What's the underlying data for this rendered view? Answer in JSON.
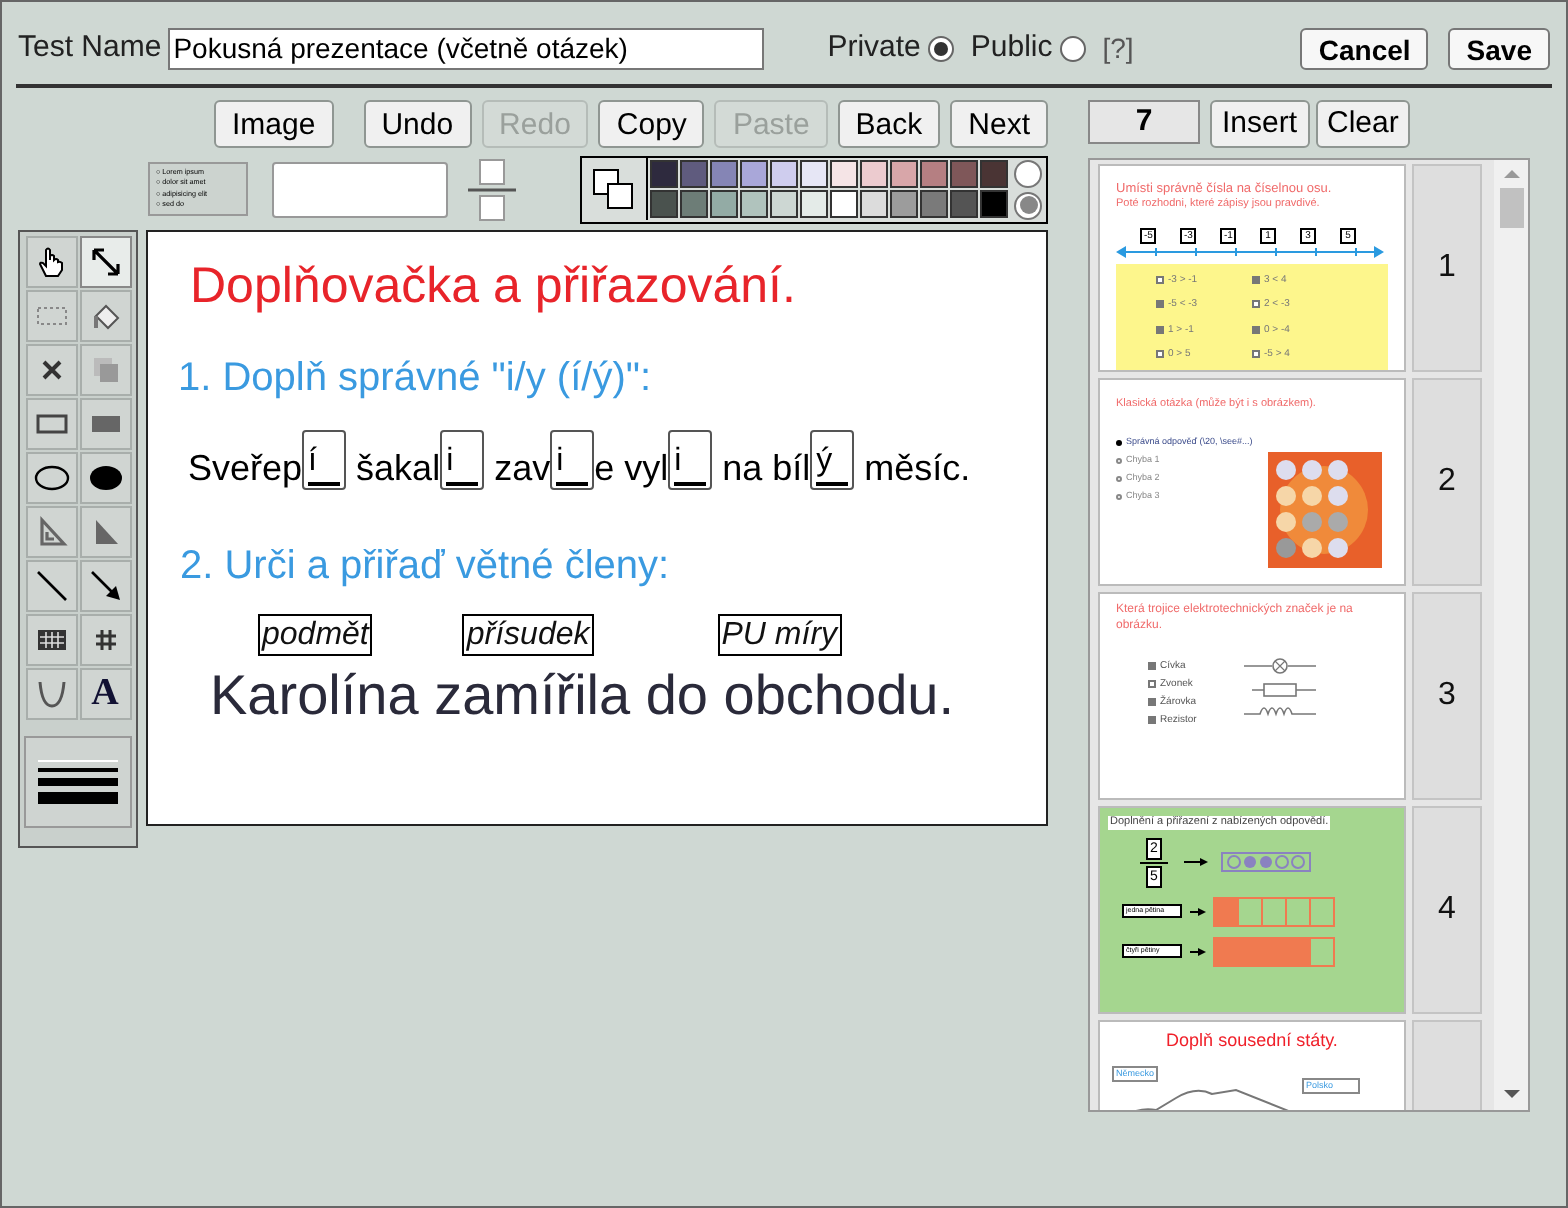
{
  "header": {
    "test_name_label": "Test Name",
    "test_name_value": "Pokusná prezentace (včetně otázek)",
    "visibility": [
      {
        "label": "Private",
        "selected": true
      },
      {
        "label": "Public",
        "selected": false
      }
    ],
    "help": "[?]",
    "buttons": [
      "Cancel",
      "Save"
    ]
  },
  "toolbar": [
    {
      "label": "Image",
      "disabled": false
    },
    {
      "label": "Undo",
      "disabled": false
    },
    {
      "label": "Redo",
      "disabled": true
    },
    {
      "label": "Copy",
      "disabled": false
    },
    {
      "label": "Paste",
      "disabled": true
    },
    {
      "label": "Back",
      "disabled": false
    },
    {
      "label": "Next",
      "disabled": false
    }
  ],
  "list_style_preview": [
    "○ Lorem ipsum",
    "○ dolor sit amet",
    "○ adipisicing elit",
    "○ sed do"
  ],
  "palette": {
    "swatches": [
      {
        "color": "#2e2a3e"
      },
      {
        "color": "#5f5b7e"
      },
      {
        "color": "#8585b5"
      },
      {
        "color": "#a9a7d9"
      },
      {
        "color": "#cfcdee"
      },
      {
        "color": "#e6e6f5"
      },
      {
        "color": "#f5e4e6"
      },
      {
        "color": "#eccbcf"
      },
      {
        "color": "#d8a6a9"
      },
      {
        "color": "#b57f82"
      },
      {
        "color": "#7f5759"
      },
      {
        "color": "#4a3434"
      },
      {
        "color": "#4a524e"
      },
      {
        "color": "#6d7d77"
      },
      {
        "color": "#93aba5"
      },
      {
        "color": "#b0c3bd"
      },
      {
        "color": "#cdd7d3"
      },
      {
        "color": "#e4ebe8"
      },
      {
        "color": "#ffffff"
      },
      {
        "color": "#dcdcdc"
      },
      {
        "color": "#9c9c9c"
      },
      {
        "color": "#7a7a7a"
      },
      {
        "color": "#545454"
      },
      {
        "color": "#000000"
      }
    ],
    "modes": [
      {
        "selected": false
      },
      {
        "selected": true
      }
    ]
  },
  "tools": [
    {
      "kind": "hand",
      "selected": false
    },
    {
      "kind": "resize",
      "selected": true
    },
    {
      "kind": "select",
      "selected": false
    },
    {
      "kind": "fill",
      "selected": false
    },
    {
      "kind": "delete",
      "selected": false
    },
    {
      "kind": "duplicate",
      "selected": false
    },
    {
      "kind": "rect",
      "selected": false
    },
    {
      "kind": "rect_filled",
      "selected": false
    },
    {
      "kind": "ellipse",
      "selected": false
    },
    {
      "kind": "ellipse_filled",
      "selected": false
    },
    {
      "kind": "triangle",
      "selected": false
    },
    {
      "kind": "triangle_filled",
      "selected": false
    },
    {
      "kind": "line",
      "selected": false
    },
    {
      "kind": "arrow",
      "selected": false
    },
    {
      "kind": "table",
      "selected": false
    },
    {
      "kind": "grid",
      "selected": false
    },
    {
      "kind": "parabola",
      "selected": false
    },
    {
      "kind": "text",
      "selected": false,
      "label": "A"
    }
  ],
  "slide": {
    "title": "Doplňovačka a přiřazování.",
    "question_1": "1. Doplň správné \"i/y (í/ý)\":",
    "sentence": [
      {
        "kind": "text",
        "text": "Sveřep"
      },
      {
        "kind": "blank",
        "text": "í"
      },
      {
        "kind": "text",
        "text": " šakal"
      },
      {
        "kind": "blank",
        "text": "i"
      },
      {
        "kind": "text",
        "text": " zav"
      },
      {
        "kind": "blank",
        "text": "i"
      },
      {
        "kind": "text",
        "text": "e vyl"
      },
      {
        "kind": "blank",
        "text": "i"
      },
      {
        "kind": "text",
        "text": " na bíl"
      },
      {
        "kind": "blank",
        "text": "ý"
      },
      {
        "kind": "text",
        "text": " měsíc."
      }
    ],
    "question_2": "2. Urči a přiřaď větné členy:",
    "labels": [
      "podmět",
      "přísudek",
      "PU míry"
    ],
    "sentence_2": "Karolína zamířila do obchodu."
  },
  "slides_panel": {
    "counter": "7",
    "buttons": [
      "Insert",
      "Clear"
    ],
    "slides": [
      {
        "kind": "numberline",
        "number": "1",
        "title": "Umísti správně čísla na číselnou osu.",
        "subtitle": "Poté rozhodni, které zápisy jsou pravdivé.",
        "ticks": [
          "-5",
          "-3",
          "-1",
          "1",
          "3",
          "5"
        ],
        "items": [
          {
            "text": "-3 > -1",
            "checked": false
          },
          {
            "text": "3 < 4",
            "checked": true
          },
          {
            "text": "-5 < -3",
            "checked": true
          },
          {
            "text": "2 < -3",
            "checked": false
          },
          {
            "text": "1 > -1",
            "checked": true
          },
          {
            "text": "0 > -4",
            "checked": true
          },
          {
            "text": "0 > 5",
            "checked": false
          },
          {
            "text": "-5 > 4",
            "checked": false
          }
        ]
      },
      {
        "kind": "quiz",
        "number": "2",
        "title": "Klasická otázka (může být i s obrázkem).",
        "items": [
          {
            "text": "Správná odpověď (\\20, \\see#...)",
            "checked": true
          },
          {
            "text": "Chyba 1",
            "checked": false
          },
          {
            "text": "Chyba 2",
            "checked": false
          },
          {
            "text": "Chyba 3",
            "checked": false
          }
        ]
      },
      {
        "kind": "symbols",
        "number": "3",
        "title": "Která trojice elektrotechnických značek je na obrázku.",
        "items": [
          {
            "text": "Cívka",
            "checked": true
          },
          {
            "text": "Zvonek",
            "checked": false
          },
          {
            "text": "Žárovka",
            "checked": true
          },
          {
            "text": "Rezistor",
            "checked": true
          }
        ]
      },
      {
        "kind": "fractions",
        "number": "4",
        "title": "Doplnění a přiřazení z nabízených odpovědí.",
        "numerator": "2",
        "denominator": "5",
        "labels": [
          "jedna pětina",
          "čtyři pětiny"
        ]
      },
      {
        "kind": "map",
        "title": "Doplň sousední státy.",
        "labels": [
          "Německo",
          "Polsko"
        ]
      }
    ]
  }
}
